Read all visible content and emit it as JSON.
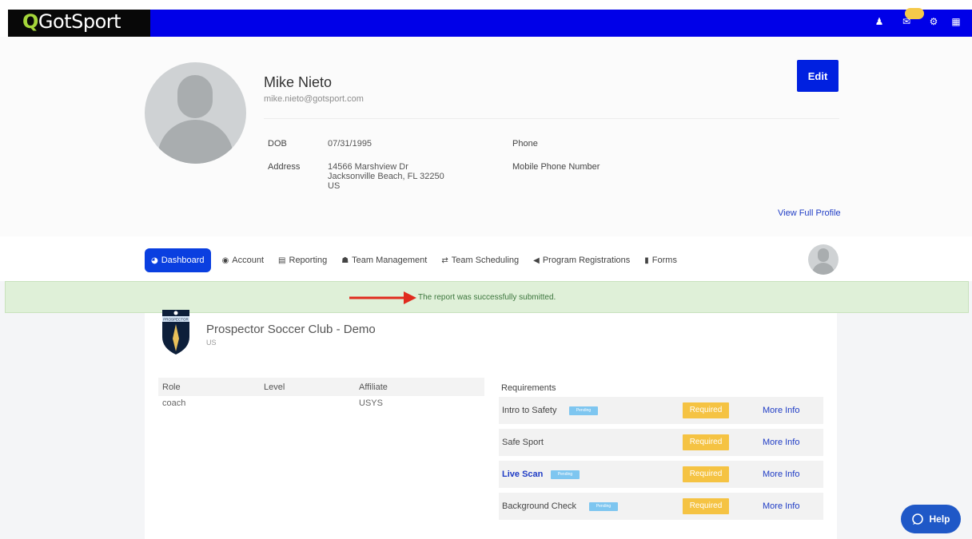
{
  "header": {
    "logo_text": "GotSport",
    "icons": [
      "user-icon",
      "mail-icon",
      "gear-icon",
      "grid-icon"
    ],
    "mail_badge": ""
  },
  "profile": {
    "name": "Mike Nieto",
    "email": "mike.nieto@gotsport.com",
    "dob_label": "DOB",
    "dob": "07/31/1995",
    "address_label": "Address",
    "address_line1": "14566 Marshview Dr",
    "address_line2": "Jacksonville Beach, FL 32250",
    "address_line3": "US",
    "phone_label": "Phone",
    "mobile_label": "Mobile Phone Number",
    "edit_label": "Edit",
    "view_full_label": "View Full Profile"
  },
  "nav": {
    "items": [
      {
        "label": "Dashboard",
        "icon": "dashboard-icon",
        "glyph": "◕"
      },
      {
        "label": "Account",
        "icon": "account-icon",
        "glyph": "◉"
      },
      {
        "label": "Reporting",
        "icon": "reporting-icon",
        "glyph": "▤"
      },
      {
        "label": "Team Management",
        "icon": "team-icon",
        "glyph": "☗"
      },
      {
        "label": "Team Scheduling",
        "icon": "scheduling-icon",
        "glyph": "⇄"
      },
      {
        "label": "Program Registrations",
        "icon": "send-icon",
        "glyph": "◀"
      },
      {
        "label": "Forms",
        "icon": "forms-icon",
        "glyph": "▮"
      }
    ]
  },
  "alert": {
    "message": "The report was successfully submitted."
  },
  "club": {
    "name": "Prospector Soccer Club - Demo",
    "country": "US",
    "logo_text": "PROSPECTOR"
  },
  "roles": {
    "headers": [
      "Role",
      "Level",
      "Affiliate"
    ],
    "rows": [
      [
        "coach",
        "",
        "USYS"
      ]
    ]
  },
  "requirements": {
    "title": "Requirements",
    "items": [
      {
        "name": "Intro to Safety",
        "pending": "Pending",
        "status": "Required",
        "link": "More Info"
      },
      {
        "name": "Safe Sport",
        "pending": "",
        "status": "Required",
        "link": "More Info"
      },
      {
        "name": "Live Scan",
        "pending": "Pending",
        "status": "Required",
        "link": "More Info"
      },
      {
        "name": "Background Check",
        "pending": "Pending",
        "status": "Required",
        "link": "More Info"
      }
    ]
  },
  "help": {
    "label": "Help"
  },
  "colors": {
    "brand_blue": "#0000e8",
    "accent_green": "#a5d63a",
    "required_yellow": "#f5c343",
    "pending_blue": "#7ec6f0",
    "success_bg": "#dff0d8"
  }
}
